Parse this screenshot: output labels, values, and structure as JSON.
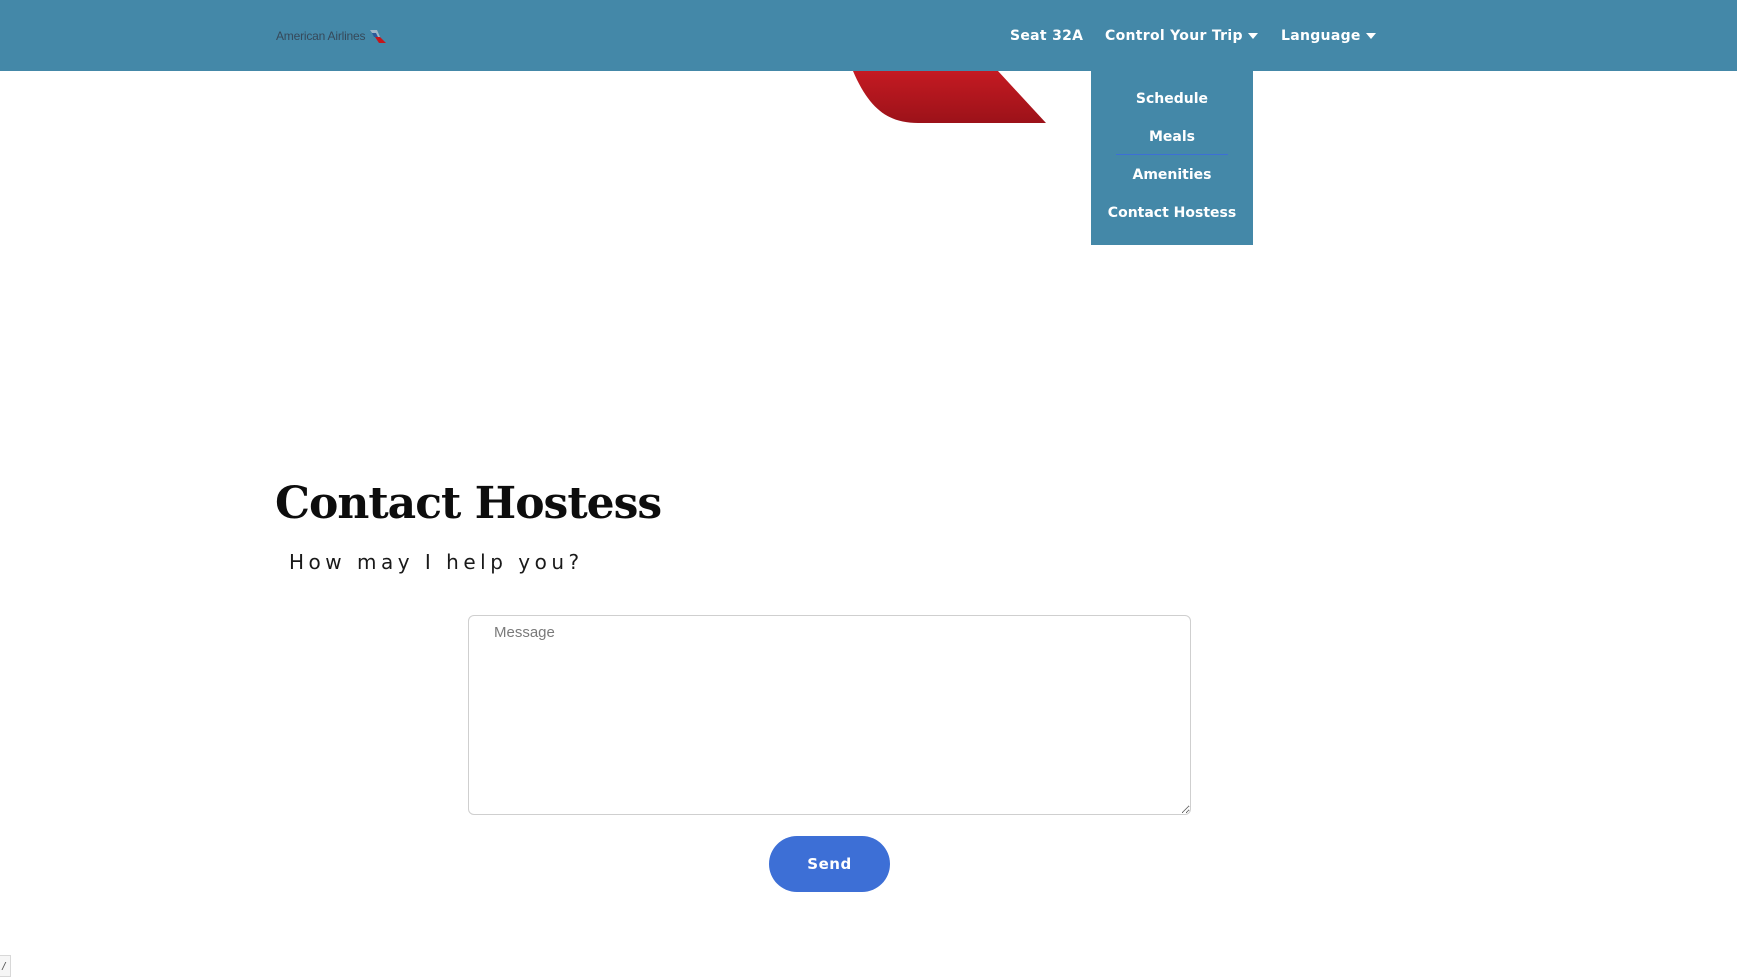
{
  "brand": {
    "name": "American Airlines",
    "colors": {
      "navbar": "#4488a8",
      "accent": "#3d6fd6",
      "tail_red": "#b5161f"
    }
  },
  "nav": {
    "seat": "Seat 32A",
    "control_trip": "Control Your Trip",
    "language": "Language"
  },
  "dropdown": {
    "items": [
      {
        "label": "Schedule"
      },
      {
        "label": "Meals"
      },
      {
        "label": "Amenities"
      },
      {
        "label": "Contact Hostess"
      }
    ]
  },
  "page": {
    "title": "Contact Hostess",
    "subtitle": "How may I help you?"
  },
  "form": {
    "message_placeholder": "Message",
    "send_label": "Send"
  },
  "footer": {
    "corner_text": "/"
  }
}
